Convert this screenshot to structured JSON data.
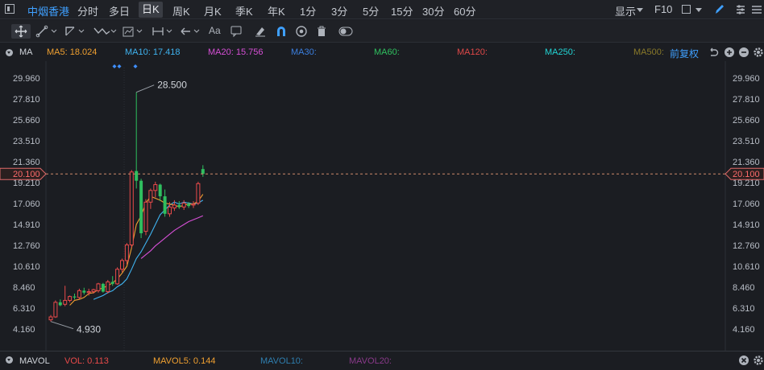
{
  "toolbar": {
    "stock_name": "中烟香港",
    "periods": [
      "分时",
      "多日",
      "日K",
      "周K",
      "月K",
      "季K",
      "年K",
      "1分",
      "3分",
      "5分",
      "15分",
      "30分",
      "60分"
    ],
    "active_period": "日K",
    "display_label": "显示",
    "f10_label": "F10"
  },
  "ma_bar": {
    "title": "MA",
    "items": [
      {
        "label": "MA5: 18.024",
        "color": "#f0a030"
      },
      {
        "label": "MA10: 17.418",
        "color": "#3fb3f0"
      },
      {
        "label": "MA20: 15.756",
        "color": "#d64fd6"
      },
      {
        "label": "MA30:",
        "color": "#3b7fe0"
      },
      {
        "label": "MA60:",
        "color": "#2fc15f"
      },
      {
        "label": "MA120:",
        "color": "#e04848"
      },
      {
        "label": "MA250:",
        "color": "#22d4d4"
      },
      {
        "label": "MA500:",
        "color": "#8a7a2a"
      }
    ],
    "adjust_label": "前复权"
  },
  "price_axis": {
    "ticks": [
      "29.960",
      "27.810",
      "25.660",
      "23.510",
      "21.360",
      "19.210",
      "17.060",
      "14.910",
      "12.760",
      "10.610",
      "8.460",
      "6.310",
      "4.160"
    ],
    "current_price": "20.100",
    "max_label": "28.500",
    "min_label": "4.930"
  },
  "chart_data": {
    "type": "candlestick",
    "ylim": [
      4.16,
      29.96
    ],
    "candles": [
      {
        "o": 5.1,
        "h": 5.6,
        "l": 4.93,
        "c": 5.4
      },
      {
        "o": 5.4,
        "h": 7.1,
        "l": 5.3,
        "c": 6.9
      },
      {
        "o": 6.9,
        "h": 7.2,
        "l": 6.5,
        "c": 6.6
      },
      {
        "o": 6.7,
        "h": 8.6,
        "l": 6.5,
        "c": 7.1
      },
      {
        "o": 7.1,
        "h": 7.6,
        "l": 6.9,
        "c": 7.5
      },
      {
        "o": 7.5,
        "h": 7.8,
        "l": 7.2,
        "c": 7.4
      },
      {
        "o": 7.4,
        "h": 8.3,
        "l": 7.2,
        "c": 8.1
      },
      {
        "o": 8.1,
        "h": 8.4,
        "l": 7.7,
        "c": 7.9
      },
      {
        "o": 7.9,
        "h": 8.3,
        "l": 7.6,
        "c": 8.0
      },
      {
        "o": 8.0,
        "h": 8.3,
        "l": 7.8,
        "c": 8.2
      },
      {
        "o": 8.1,
        "h": 8.9,
        "l": 7.9,
        "c": 8.8
      },
      {
        "o": 8.8,
        "h": 8.9,
        "l": 7.9,
        "c": 8.0
      },
      {
        "o": 8.0,
        "h": 9.2,
        "l": 7.8,
        "c": 9.0
      },
      {
        "o": 9.0,
        "h": 9.6,
        "l": 8.6,
        "c": 8.8
      },
      {
        "o": 8.8,
        "h": 10.5,
        "l": 8.7,
        "c": 10.3
      },
      {
        "o": 10.3,
        "h": 11.4,
        "l": 10.0,
        "c": 11.2
      },
      {
        "o": 11.2,
        "h": 13.0,
        "l": 10.8,
        "c": 12.8
      },
      {
        "o": 12.8,
        "h": 20.5,
        "l": 12.5,
        "c": 20.3
      },
      {
        "o": 20.4,
        "h": 28.5,
        "l": 18.6,
        "c": 19.4
      },
      {
        "o": 19.4,
        "h": 19.6,
        "l": 13.5,
        "c": 14.0
      },
      {
        "o": 14.2,
        "h": 17.5,
        "l": 13.8,
        "c": 17.2
      },
      {
        "o": 17.2,
        "h": 18.6,
        "l": 16.5,
        "c": 18.4
      },
      {
        "o": 18.4,
        "h": 19.3,
        "l": 17.7,
        "c": 19.0
      },
      {
        "o": 19.0,
        "h": 19.1,
        "l": 17.3,
        "c": 17.8
      },
      {
        "o": 17.8,
        "h": 18.5,
        "l": 15.7,
        "c": 16.0
      },
      {
        "o": 16.0,
        "h": 17.2,
        "l": 15.7,
        "c": 16.7
      },
      {
        "o": 16.6,
        "h": 17.4,
        "l": 16.3,
        "c": 16.9
      },
      {
        "o": 16.9,
        "h": 17.3,
        "l": 16.5,
        "c": 16.7
      },
      {
        "o": 16.7,
        "h": 17.4,
        "l": 16.4,
        "c": 17.1
      },
      {
        "o": 17.0,
        "h": 17.2,
        "l": 16.6,
        "c": 16.8
      },
      {
        "o": 16.9,
        "h": 17.3,
        "l": 16.6,
        "c": 17.0
      },
      {
        "o": 17.1,
        "h": 19.3,
        "l": 16.9,
        "c": 19.1
      },
      {
        "o": 20.6,
        "h": 21.0,
        "l": 19.8,
        "c": 20.1
      }
    ],
    "ma5": [
      null,
      null,
      null,
      null,
      6.6,
      7.1,
      7.2,
      7.4,
      7.8,
      7.9,
      8.2,
      8.4,
      8.6,
      8.9,
      9.3,
      9.9,
      10.6,
      12.5,
      14.9,
      15.8,
      17.1,
      17.8,
      17.6,
      17.4,
      17.1,
      17.0,
      16.9,
      16.7,
      16.9,
      17.0,
      17.0,
      17.3,
      18.0
    ],
    "ma10": [
      null,
      null,
      null,
      null,
      null,
      null,
      null,
      null,
      null,
      7.2,
      7.4,
      7.6,
      7.9,
      8.1,
      8.5,
      8.8,
      9.3,
      10.3,
      11.4,
      12.1,
      13.0,
      13.9,
      14.9,
      15.9,
      16.4,
      16.9,
      17.2,
      17.0,
      17.2,
      17.1,
      17.0,
      17.1,
      17.4
    ],
    "ma20": [
      null,
      null,
      null,
      null,
      null,
      null,
      null,
      null,
      null,
      null,
      null,
      null,
      null,
      null,
      null,
      null,
      null,
      null,
      null,
      11.4,
      11.8,
      12.2,
      12.7,
      13.1,
      13.5,
      13.9,
      14.3,
      14.6,
      14.9,
      15.2,
      15.4,
      15.6,
      15.8
    ],
    "up_color": "#e84a4a",
    "down_color": "#2fbf5f"
  },
  "volume_bar": {
    "title": "MAVOL",
    "items": [
      {
        "label": "VOL: 0.113",
        "color": "#e84a4a"
      },
      {
        "label": "MAVOL5: 0.144",
        "color": "#f0a030"
      },
      {
        "label": "MAVOL10:",
        "color": "#2f7fb0"
      },
      {
        "label": "MAVOL20:",
        "color": "#8a3a8a"
      }
    ]
  }
}
